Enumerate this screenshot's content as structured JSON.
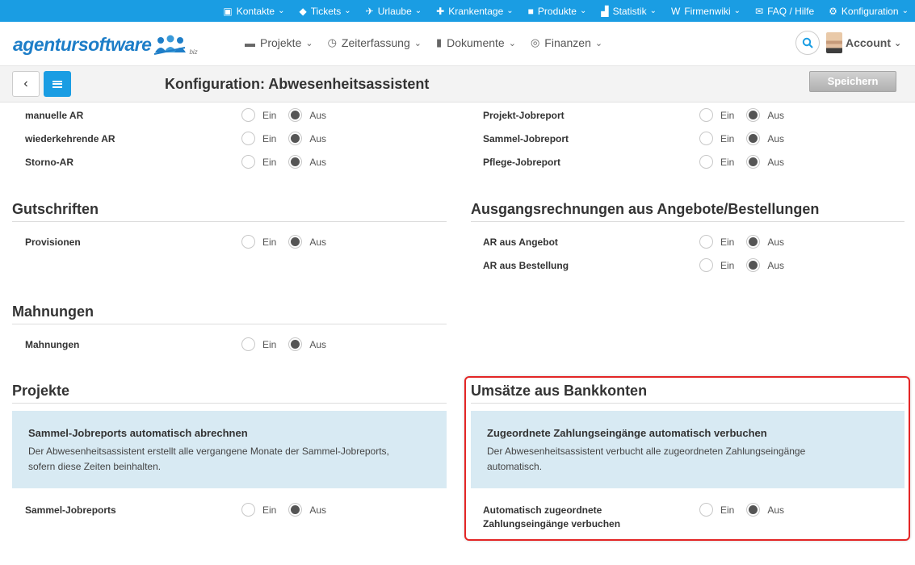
{
  "topnav": {
    "items": [
      {
        "label": "Kontakte",
        "icon": "address-book-icon"
      },
      {
        "label": "Tickets",
        "icon": "ticket-icon"
      },
      {
        "label": "Urlaube",
        "icon": "plane-icon"
      },
      {
        "label": "Krankentage",
        "icon": "medkit-icon"
      },
      {
        "label": "Produkte",
        "icon": "cube-icon"
      },
      {
        "label": "Statistik",
        "icon": "bar-chart-icon"
      },
      {
        "label": "Firmenwiki",
        "icon": "wikipedia-icon"
      },
      {
        "label": "FAQ / Hilfe",
        "icon": "comments-icon"
      },
      {
        "label": "Konfiguration",
        "icon": "gears-icon"
      }
    ]
  },
  "header": {
    "logo_text": "agentursoftware",
    "logo_suffix": "biz",
    "nav": [
      {
        "label": "Projekte",
        "icon": "briefcase-icon"
      },
      {
        "label": "Zeiterfassung",
        "icon": "clock-icon"
      },
      {
        "label": "Dokumente",
        "icon": "file-icon"
      },
      {
        "label": "Finanzen",
        "icon": "money-icon"
      }
    ],
    "account_label": "Account"
  },
  "toolbar": {
    "title": "Konfiguration: Abwesenheitsassistent",
    "save_label": "Speichern"
  },
  "radio_labels": {
    "on": "Ein",
    "off": "Aus"
  },
  "sections": {
    "top_left": {
      "rows": [
        {
          "label": "manuelle AR",
          "value": "Aus"
        },
        {
          "label": "wiederkehrende AR",
          "value": "Aus"
        },
        {
          "label": "Storno-AR",
          "value": "Aus"
        }
      ]
    },
    "top_right": {
      "rows": [
        {
          "label": "Projekt-Jobreport",
          "value": "Aus"
        },
        {
          "label": "Sammel-Jobreport",
          "value": "Aus"
        },
        {
          "label": "Pflege-Jobreport",
          "value": "Aus"
        }
      ]
    },
    "gutschriften": {
      "title": "Gutschriften",
      "rows": [
        {
          "label": "Provisionen",
          "value": "Aus"
        }
      ]
    },
    "ausgangsrechnungen": {
      "title": "Ausgangsrechnungen aus Angebote/Bestellungen",
      "rows": [
        {
          "label": "AR aus Angebot",
          "value": "Aus"
        },
        {
          "label": "AR aus Bestellung",
          "value": "Aus"
        }
      ]
    },
    "mahnungen": {
      "title": "Mahnungen",
      "rows": [
        {
          "label": "Mahnungen",
          "value": "Aus"
        }
      ]
    },
    "projekte": {
      "title": "Projekte",
      "info_title": "Sammel-Jobreports automatisch abrechnen",
      "info_text_1": "Der Abwesenheitsassistent erstellt alle vergangene Monate der Sammel-Jobreports,",
      "info_text_2": "sofern diese Zeiten beinhalten.",
      "rows": [
        {
          "label": "Sammel-Jobreports",
          "value": "Aus"
        }
      ]
    },
    "umsaetze": {
      "title": "Umsätze aus Bankkonten",
      "info_title": "Zugeordnete Zahlungseingänge automatisch verbuchen",
      "info_text_1": "Der Abwesenheitsassistent verbucht alle zugeordneten Zahlungseingänge",
      "info_text_2": "automatisch.",
      "rows": [
        {
          "label_1": "Automatisch zugeordnete",
          "label_2": "Zahlungseingänge verbuchen",
          "value": "Aus"
        }
      ]
    }
  },
  "colors": {
    "accent": "#1a9de3",
    "highlight": "#e32626",
    "infobox": "#d8eaf3"
  }
}
